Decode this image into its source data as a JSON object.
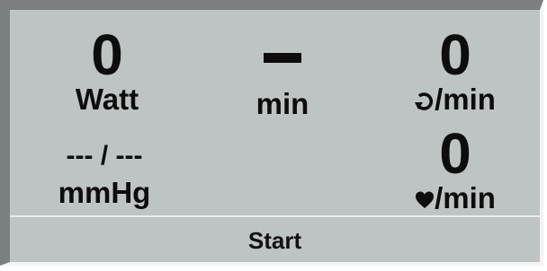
{
  "readouts": {
    "power": {
      "value": "0",
      "unit": "Watt"
    },
    "time": {
      "value": "–",
      "unit": "min"
    },
    "cadence": {
      "value": "0",
      "unit_icon": "rotation-icon",
      "unit": "/min"
    },
    "blood_pressure": {
      "value": "--- / ---",
      "unit": "mmHg"
    },
    "heart_rate": {
      "value": "0",
      "unit_icon": "heart-icon",
      "unit": "/min"
    }
  },
  "actions": {
    "start_label": "Start"
  },
  "colors": {
    "panel_background": "#bec3c4",
    "text": "#0d0d0d",
    "bevel_dark": "#7b7f80",
    "bevel_light": "#f2f3f3"
  }
}
